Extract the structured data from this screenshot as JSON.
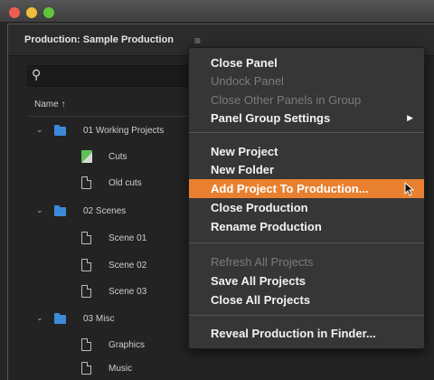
{
  "window": {
    "panel_title": "Production: Sample Production",
    "panel_menu_icon": "≡",
    "search_placeholder": ""
  },
  "project_list": {
    "column_header": "Name ↑",
    "rows": [
      {
        "type": "folder",
        "label": "01 Working Projects",
        "indent": 0
      },
      {
        "type": "sequence",
        "label": "Cuts",
        "indent": 1
      },
      {
        "type": "doc",
        "label": "Old cuts",
        "indent": 1
      },
      {
        "type": "folder",
        "label": "02 Scenes",
        "indent": 0
      },
      {
        "type": "doc",
        "label": "Scene 01",
        "indent": 1
      },
      {
        "type": "doc",
        "label": "Scene 02",
        "indent": 1
      },
      {
        "type": "doc",
        "label": "Scene 03",
        "indent": 1
      },
      {
        "type": "folder",
        "label": "03 Misc",
        "indent": 0
      },
      {
        "type": "doc",
        "label": "Graphics",
        "indent": 1
      },
      {
        "type": "doc",
        "label": "Music",
        "indent": 1
      }
    ]
  },
  "context_menu": {
    "items": [
      {
        "label": "Close Panel",
        "enabled": true
      },
      {
        "label": "Undock Panel",
        "enabled": false
      },
      {
        "label": "Close Other Panels in Group",
        "enabled": false
      },
      {
        "label": "Panel Group Settings",
        "enabled": true,
        "submenu": true
      },
      {
        "label": "New Project",
        "enabled": true
      },
      {
        "label": "New Folder",
        "enabled": true
      },
      {
        "label": "Add Project To Production...",
        "enabled": true,
        "highlighted": true
      },
      {
        "label": "Close Production",
        "enabled": true
      },
      {
        "label": "Rename Production",
        "enabled": true
      },
      {
        "label": "Refresh All Projects",
        "enabled": false
      },
      {
        "label": "Save All Projects",
        "enabled": true
      },
      {
        "label": "Close All Projects",
        "enabled": true
      },
      {
        "label": "Reveal Production in Finder...",
        "enabled": true
      }
    ]
  },
  "colors": {
    "highlight": "#e8802f",
    "folder": "#3c8ad9",
    "menu_bg": "#363636"
  }
}
